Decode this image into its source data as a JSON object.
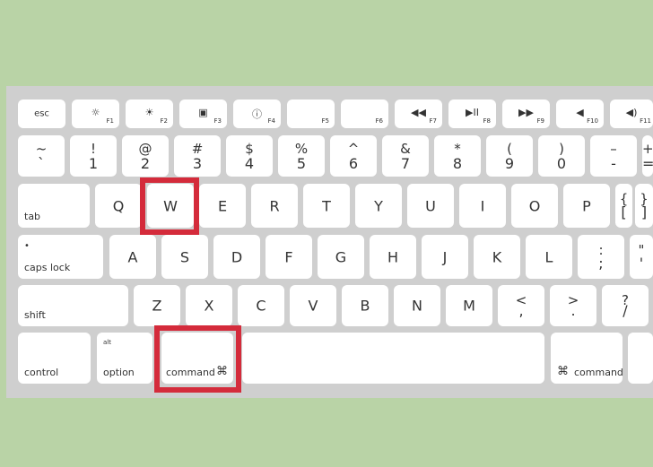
{
  "highlight_color": "#d42b3b",
  "fn_row": [
    {
      "label": "esc"
    },
    {
      "icon": "brightness-down-icon",
      "glyph": "☼",
      "fn": "F1"
    },
    {
      "icon": "brightness-up-icon",
      "glyph": "☀",
      "fn": "F2"
    },
    {
      "icon": "mission-control-icon",
      "glyph": "▣",
      "fn": "F3"
    },
    {
      "icon": "dashboard-icon",
      "glyph": "ⓘ",
      "fn": "F4"
    },
    {
      "fn": "F5"
    },
    {
      "fn": "F6"
    },
    {
      "icon": "rewind-icon",
      "glyph": "◀◀",
      "fn": "F7"
    },
    {
      "icon": "play-pause-icon",
      "glyph": "▶II",
      "fn": "F8"
    },
    {
      "icon": "fast-forward-icon",
      "glyph": "▶▶",
      "fn": "F9"
    },
    {
      "icon": "mute-icon",
      "glyph": "◀",
      "fn": "F10"
    },
    {
      "icon": "volume-down-icon",
      "glyph": "◀)",
      "fn": "F11"
    }
  ],
  "number_row": [
    {
      "top": "~",
      "bot": "`"
    },
    {
      "top": "!",
      "bot": "1"
    },
    {
      "top": "@",
      "bot": "2"
    },
    {
      "top": "#",
      "bot": "3"
    },
    {
      "top": "$",
      "bot": "4"
    },
    {
      "top": "%",
      "bot": "5"
    },
    {
      "top": "^",
      "bot": "6"
    },
    {
      "top": "&",
      "bot": "7"
    },
    {
      "top": "*",
      "bot": "8"
    },
    {
      "top": "(",
      "bot": "9"
    },
    {
      "top": ")",
      "bot": "0"
    },
    {
      "top": "–",
      "bot": "-"
    },
    {
      "top": "+",
      "bot": "="
    }
  ],
  "q_row": {
    "modifier": "tab",
    "keys": [
      "Q",
      "W",
      "E",
      "R",
      "T",
      "Y",
      "U",
      "I",
      "O",
      "P"
    ],
    "extra": [
      {
        "top": "{",
        "bot": "["
      },
      {
        "top": "}",
        "bot": "]"
      }
    ]
  },
  "a_row": {
    "modifier": "caps lock",
    "keys": [
      "A",
      "S",
      "D",
      "F",
      "G",
      "H",
      "J",
      "K",
      "L"
    ],
    "extra": [
      {
        "top": ":",
        "bot": ";"
      },
      {
        "top": "\"",
        "bot": "'"
      }
    ]
  },
  "z_row": {
    "modifier": "shift",
    "keys": [
      "Z",
      "X",
      "C",
      "V",
      "B",
      "N",
      "M"
    ],
    "extra": [
      {
        "top": "<",
        "bot": ","
      },
      {
        "top": ">",
        "bot": "."
      },
      {
        "top": "?",
        "bot": "/"
      }
    ]
  },
  "bottom_row": {
    "control": "control",
    "option_alt": "alt",
    "option": "option",
    "command": "command",
    "command_symbol": "⌘",
    "right_command": "command"
  },
  "highlighted_keys": [
    "W",
    "command"
  ]
}
